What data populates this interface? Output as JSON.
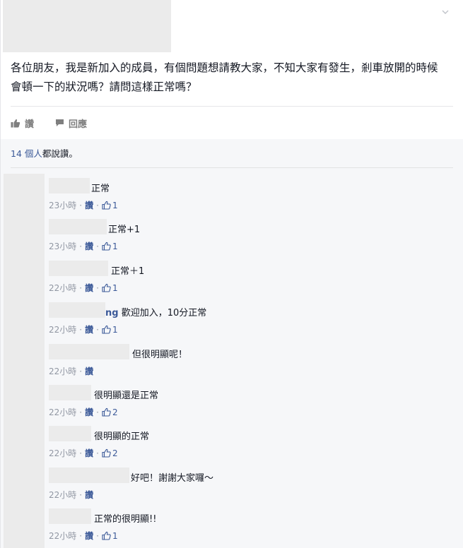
{
  "post": {
    "text": "各位朋友，我是新加入的成員，有個問題想請教大家，不知大家有發生，剎車放開的時候會頓一下的狀況嗎？請問這樣正常嗎？"
  },
  "actions": {
    "like_label": "讚",
    "comment_label": "回應"
  },
  "likes_summary": {
    "count_text": "14 個人",
    "suffix": "都說讚。"
  },
  "comments": [
    {
      "text": "正常",
      "time": "23小時",
      "like_label": "讚",
      "likes": "1"
    },
    {
      "text": "正常+1",
      "time": "23小時",
      "like_label": "讚",
      "likes": "1"
    },
    {
      "text": "正常＋1",
      "time": "22小時",
      "like_label": "讚",
      "likes": "1"
    },
    {
      "text_prefix": "ng",
      "text": " 歡迎加入，10分正常",
      "time": "22小時",
      "like_label": "讚",
      "likes": "1"
    },
    {
      "text": "但很明顯呢！",
      "time": "22小時",
      "like_label": "讚",
      "likes": ""
    },
    {
      "text": "很明顯還是正常",
      "time": "22小時",
      "like_label": "讚",
      "likes": "2"
    },
    {
      "text": "很明顯的正常",
      "time": "22小時",
      "like_label": "讚",
      "likes": "2"
    },
    {
      "text": "好吧！謝謝大家囉～",
      "time": "22小時",
      "like_label": "讚",
      "likes": ""
    },
    {
      "text": "正常的很明顯!!",
      "time": "22小時",
      "like_label": "讚",
      "likes": "1"
    }
  ],
  "colors": {
    "link": "#3b5998",
    "meta": "#9197a3",
    "background_comments": "#f6f7f9"
  }
}
